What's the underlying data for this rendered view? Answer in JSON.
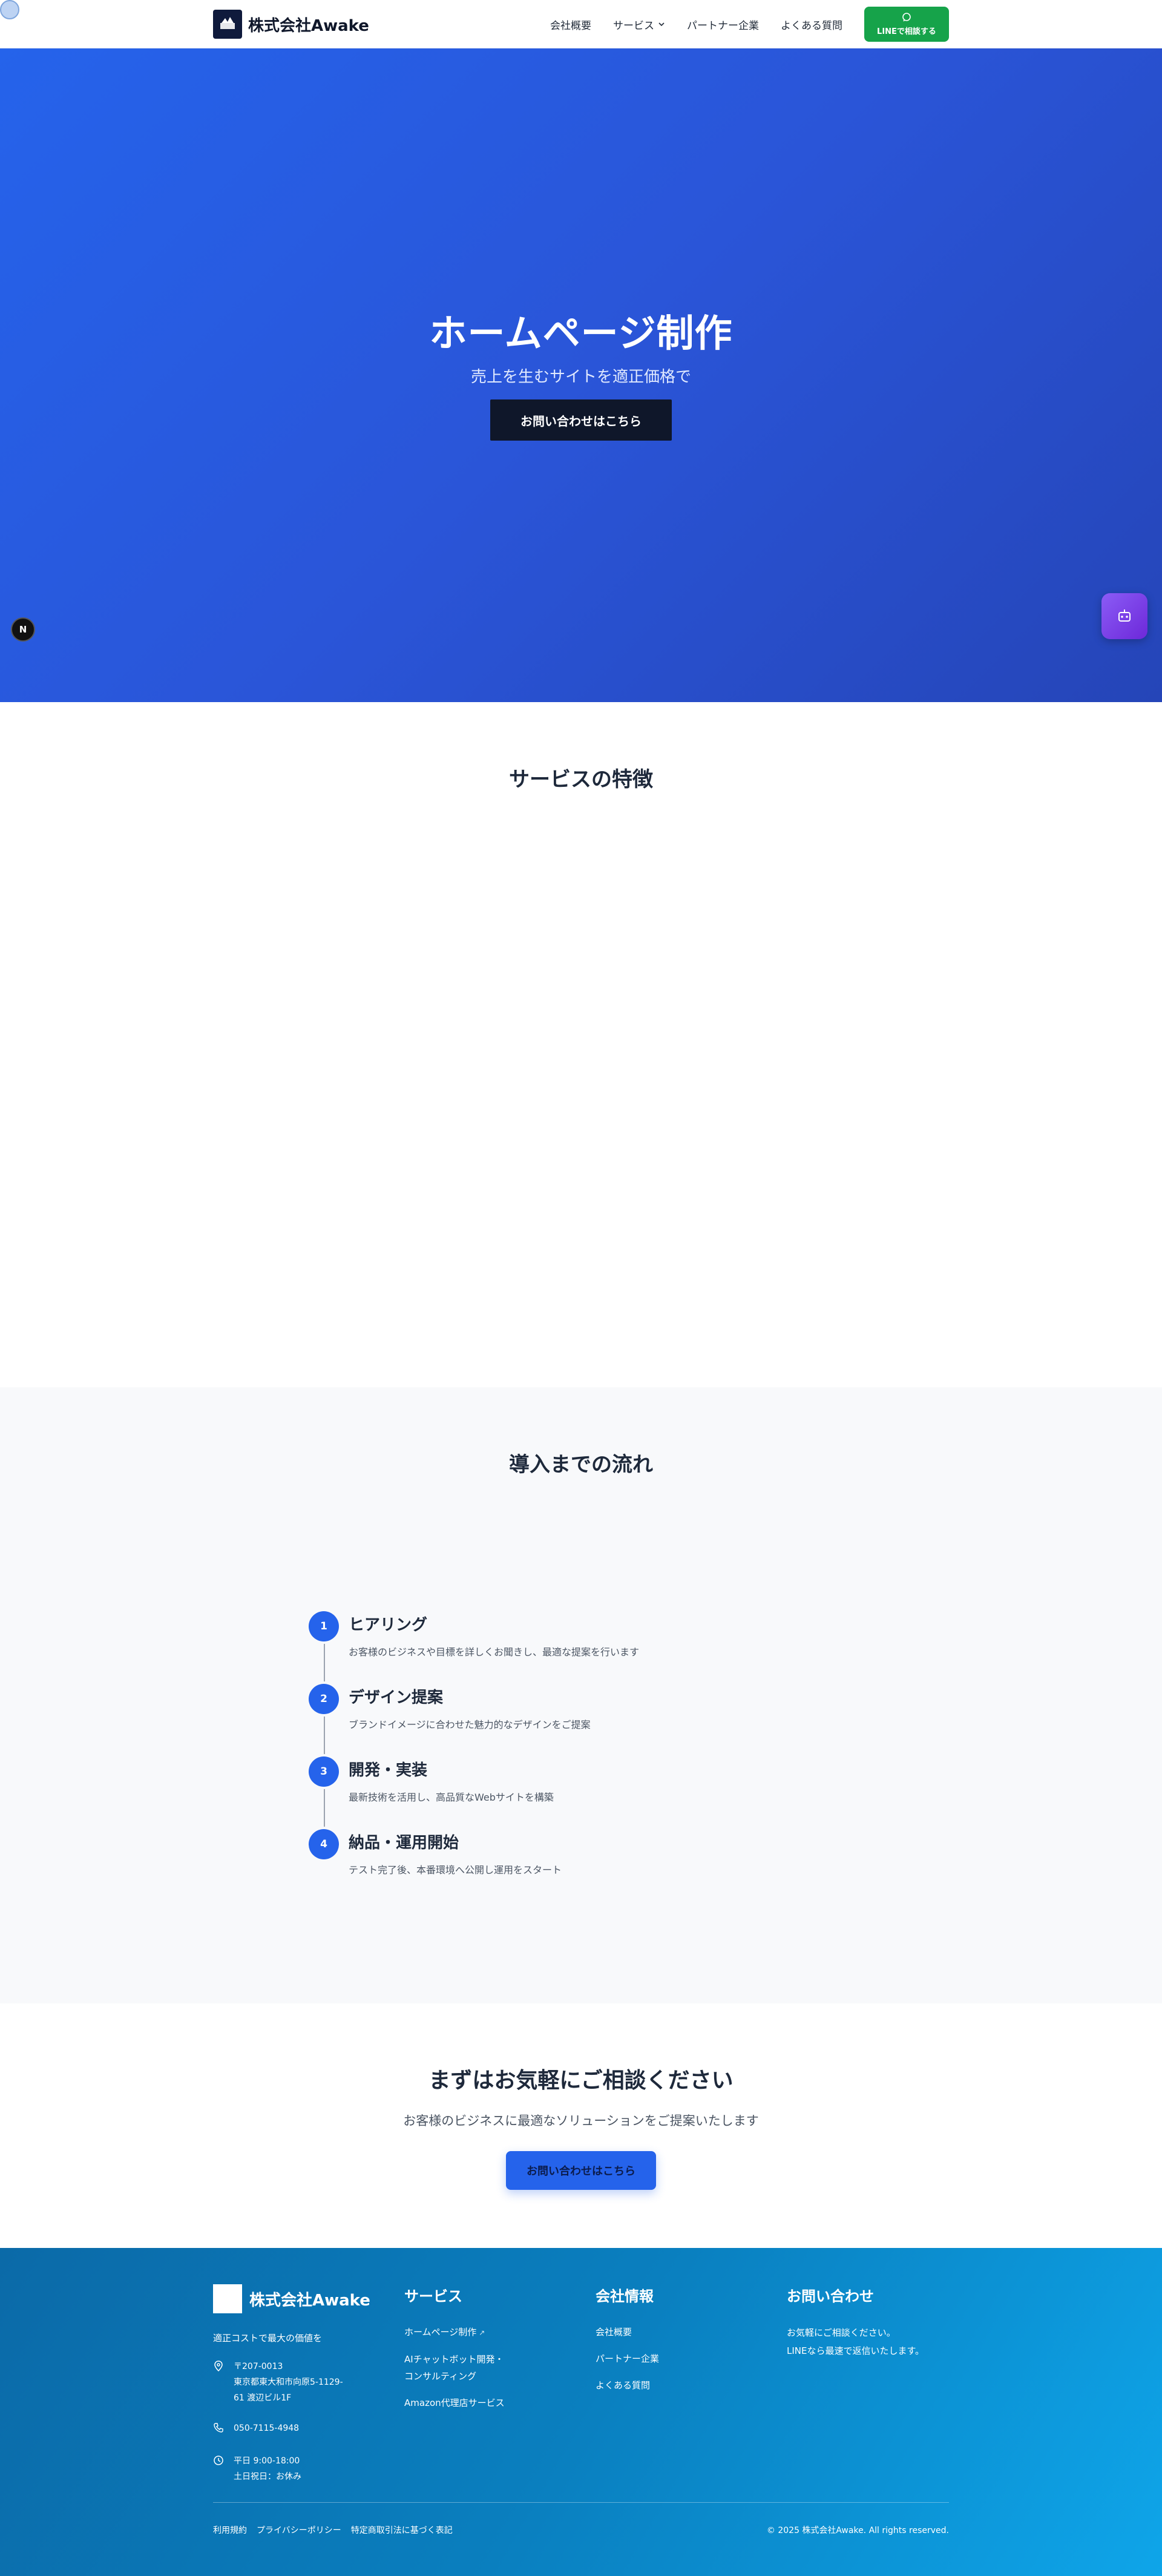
{
  "header": {
    "logo_text": "株式会社Awake",
    "nav": [
      "会社概要",
      "サービス",
      "パートナー企業",
      "よくある質問"
    ],
    "line_button": "LINEで相談する"
  },
  "hero": {
    "title": "ホームページ制作",
    "subtitle": "売上を生むサイトを適正価格で",
    "cta": "お問い合わせはこちら",
    "badge": "N"
  },
  "features": {
    "title": "サービスの特徴"
  },
  "flow": {
    "title": "導入までの流れ",
    "steps": [
      {
        "num": "1",
        "title": "ヒアリング",
        "desc": "お客様のビジネスや目標を詳しくお聞きし、最適な提案を行います"
      },
      {
        "num": "2",
        "title": "デザイン提案",
        "desc": "ブランドイメージに合わせた魅力的なデザインをご提案"
      },
      {
        "num": "3",
        "title": "開発・実装",
        "desc": "最新技術を活用し、高品質なWebサイトを構築"
      },
      {
        "num": "4",
        "title": "納品・運用開始",
        "desc": "テスト完了後、本番環境へ公開し運用をスタート"
      }
    ]
  },
  "cta": {
    "title": "まずはお気軽にご相談ください",
    "subtitle": "お客様のビジネスに最適なソリューションをご提案いたします",
    "button": "お問い合わせはこちら"
  },
  "footer": {
    "logo_text": "株式会社Awake",
    "tagline": "適正コストで最大の価値を",
    "address_lines": [
      "〒207-0013",
      "東京都東大和市向原5-1129-",
      "61 渡辺ビル1F"
    ],
    "phone": "050-7115-4948",
    "hours_lines": [
      "平日 9:00-18:00",
      "土日祝日：お休み"
    ],
    "services_title": "サービス",
    "services": [
      "ホームページ制作",
      "AIチャットボット開発・",
      "コンサルティング",
      "Amazon代理店サービス"
    ],
    "company_title": "会社情報",
    "company_links": [
      "会社概要",
      "パートナー企業",
      "よくある質問"
    ],
    "contact_title": "お問い合わせ",
    "contact_lines": [
      "お気軽にご相談ください。",
      "LINEなら最速で返信いたします。"
    ],
    "bottom_links": [
      "利用規約",
      "プライバシーポリシー",
      "特定商取引法に基づく表記"
    ],
    "copyright": "© 2025 株式会社Awake. All rights reserved."
  },
  "colors": {
    "primary": "#2563eb",
    "line_green": "#16a34a",
    "dark": "#0f172a",
    "chatbot": "#7c3aed"
  }
}
